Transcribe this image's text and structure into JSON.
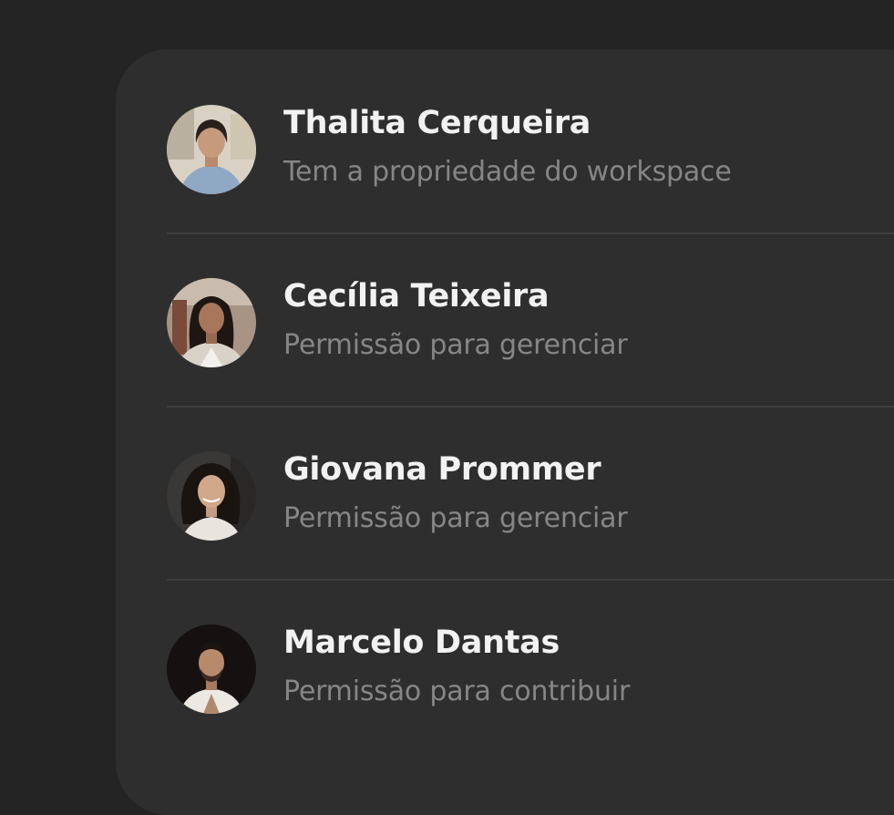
{
  "members": [
    {
      "name": "Thalita Cerqueira",
      "role": "Tem a propriedade do workspace"
    },
    {
      "name": "Cecília Teixeira",
      "role": "Permissão para gerenciar"
    },
    {
      "name": "Giovana Prommer",
      "role": "Permissão para gerenciar"
    },
    {
      "name": "Marcelo Dantas",
      "role": "Permissão para contribuir"
    }
  ]
}
